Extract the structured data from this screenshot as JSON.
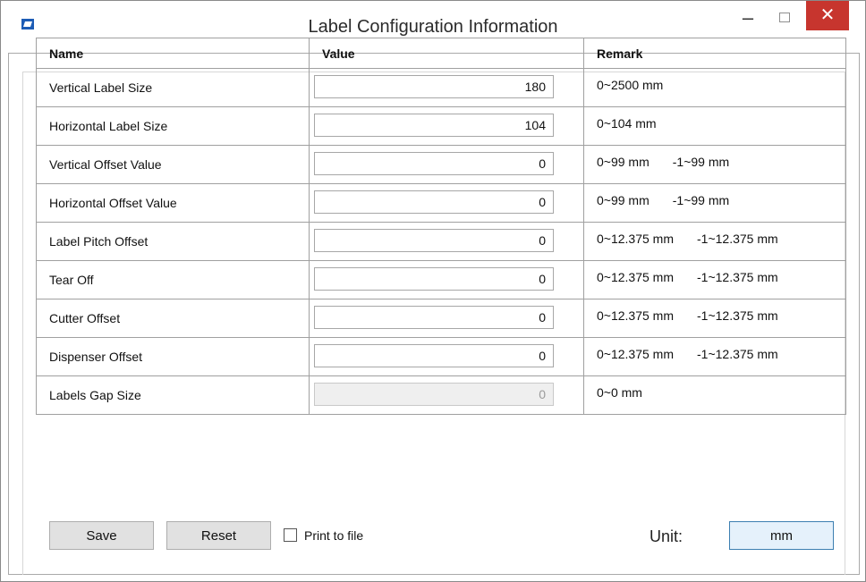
{
  "window": {
    "title": "Label Configuration Information"
  },
  "table": {
    "headers": {
      "name": "Name",
      "value": "Value",
      "remark": "Remark"
    },
    "rows": [
      {
        "name": "Vertical Label Size",
        "value": "180",
        "remark_a": "0~2500 mm",
        "remark_b": "",
        "enabled": true
      },
      {
        "name": "Horizontal Label Size",
        "value": "104",
        "remark_a": "0~104 mm",
        "remark_b": "",
        "enabled": true
      },
      {
        "name": "Vertical Offset Value",
        "value": "0",
        "remark_a": "0~99 mm",
        "remark_b": "-1~99 mm",
        "enabled": true
      },
      {
        "name": "Horizontal Offset Value",
        "value": "0",
        "remark_a": "0~99 mm",
        "remark_b": "-1~99 mm",
        "enabled": true
      },
      {
        "name": "Label Pitch Offset",
        "value": "0",
        "remark_a": "0~12.375 mm",
        "remark_b": "-1~12.375 mm",
        "enabled": true
      },
      {
        "name": "Tear Off",
        "value": "0",
        "remark_a": "0~12.375 mm",
        "remark_b": "-1~12.375 mm",
        "enabled": true
      },
      {
        "name": "Cutter Offset",
        "value": "0",
        "remark_a": "0~12.375 mm",
        "remark_b": "-1~12.375 mm",
        "enabled": true
      },
      {
        "name": "Dispenser Offset",
        "value": "0",
        "remark_a": "0~12.375 mm",
        "remark_b": "-1~12.375 mm",
        "enabled": true
      },
      {
        "name": "Labels Gap Size",
        "value": "0",
        "remark_a": "0~0 mm",
        "remark_b": "",
        "enabled": false
      }
    ]
  },
  "buttons": {
    "save": "Save",
    "reset": "Reset",
    "unit_value": "mm"
  },
  "print_to_file": {
    "label": "Print to file",
    "checked": false
  },
  "unit": {
    "label": "Unit:"
  },
  "titlebar": {
    "minimize": "–",
    "close": "✕"
  }
}
